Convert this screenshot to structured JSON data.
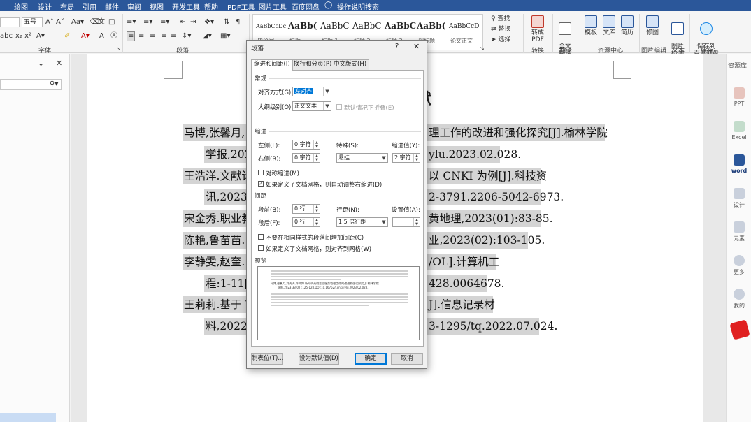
{
  "menubar": {
    "tabs": [
      "绘图",
      "设计",
      "布局",
      "引用",
      "邮件",
      "审阅",
      "视图",
      "开发工具",
      "帮助",
      "PDF工具",
      "图片工具",
      "百度网盘"
    ],
    "tell_me": "操作说明搜索"
  },
  "ribbon": {
    "font": {
      "font_name": "",
      "font_size": "五号",
      "group_label": "字体"
    },
    "paragraph": {
      "group_label": "段落"
    },
    "styles": {
      "items": [
        {
          "sample": "AaBbCcDc",
          "name": "毕论图"
        },
        {
          "sample": "AaBb(",
          "name": "标题"
        },
        {
          "sample": "AaBbC",
          "name": "标题 1"
        },
        {
          "sample": "AaBbC",
          "name": "标题 2"
        },
        {
          "sample": "AaBbC",
          "name": "标题 3"
        },
        {
          "sample": "AaBb(",
          "name": "副标题"
        },
        {
          "sample": "AaBbCcD",
          "name": "论文正文"
        }
      ]
    },
    "editing": {
      "find": "查找",
      "replace": "替换",
      "select": "选择"
    },
    "buttons": {
      "convert_pdf": "转成PDF",
      "full_translate": "全文\n翻译",
      "template": "模板",
      "library": "文库",
      "resume": "简历",
      "image_repair": "修图",
      "ocr": "图片\n检测",
      "save_baidu": "保存到\n百度网盘"
    },
    "group_labels": {
      "convert": "转换",
      "translate": "翻译",
      "resource": "资源中心",
      "image_edit": "图片编辑",
      "text": "文本",
      "save": "保存"
    }
  },
  "document": {
    "heading": "献",
    "lines": [
      "马博,张馨月,",
      "理工作的改进和强化探究[J].榆林学院",
      "学报,202",
      "ylu.2023.02.028.",
      "王浩洋.文献计",
      "以 CNKI 为例[J].科技资",
      "讯,2023,2",
      "2-3791.2206-5042-6973.",
      "宋金秀.职业教",
      "黄地理,2023(01):83-85.",
      "陈艳,鲁苗苗.",
      "业,2023(02):103-105.",
      "李静雯,赵奎.",
      "/OL].计算机工",
      "程:1-11[2",
      "428.0064678.",
      "王莉莉.基于 V",
      "J].信息记录材",
      "料,2022,2",
      "3-1295/tq.2022.07.024."
    ]
  },
  "right_pane": {
    "title": "资源库",
    "items": [
      "PPT",
      "Excel",
      "word",
      "设计",
      "元素",
      "更多",
      "我的"
    ]
  },
  "dialog": {
    "title": "段落",
    "help": "?",
    "close": "✕",
    "tabs": [
      "缩进和间距(I)",
      "换行和分页(P)",
      "中文版式(H)"
    ],
    "general": {
      "section": "常规",
      "alignment_label": "对齐方式(G):",
      "alignment_value": "左对齐",
      "outline_label": "大纲级别(O):",
      "outline_value": "正文文本",
      "collapsed_label": "默认情况下折叠(E)"
    },
    "indent": {
      "section": "缩进",
      "left_label": "左侧(L):",
      "left_value": "0 字符",
      "right_label": "右侧(R):",
      "right_value": "0 字符",
      "special_label": "特殊(S):",
      "special_value": "悬挂",
      "by_label": "缩进值(Y):",
      "by_value": "2 字符",
      "mirror_label": "对称缩进(M)",
      "auto_adjust_label": "如果定义了文档网格，则自动调整右缩进(D)"
    },
    "spacing": {
      "section": "间距",
      "before_label": "段前(B):",
      "before_value": "0 行",
      "after_label": "段后(F):",
      "after_value": "0 行",
      "line_label": "行距(N):",
      "line_value": "1.5 倍行距",
      "at_label": "设置值(A):",
      "at_value": "",
      "no_space_label": "不要在相同样式的段落间增加间距(C)",
      "snap_label": "如果定义了文档网格，则对齐到网格(W)"
    },
    "preview": {
      "section": "预览",
      "sample_lines": [
        "马博,张馨月,刘涛涛,许文博.新时代高校志愿服务管理工作的改进和强化探究[J].榆林学院",
        "学报,2023,33(02):125-128.DOI:10.16752/j.cnki.jylu.2023.02.028."
      ]
    },
    "buttons": {
      "tabs": "制表位(T)...",
      "set_default": "设为默认值(D)",
      "ok": "确定",
      "cancel": "取消"
    }
  }
}
